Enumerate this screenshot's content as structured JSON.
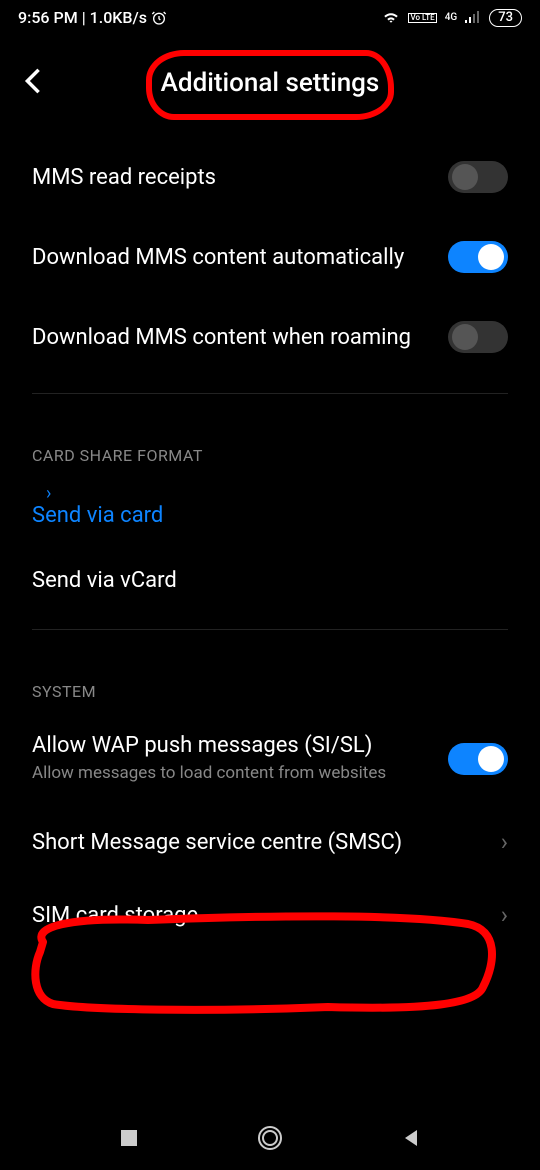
{
  "status": {
    "time": "9:56 PM",
    "speed": "1.0KB/s",
    "network": "4G",
    "volte": "Vo LTE",
    "battery": "73"
  },
  "header": {
    "title": "Additional settings"
  },
  "settings": {
    "mms_read_receipts": {
      "label": "MMS read receipts",
      "on": false
    },
    "download_auto": {
      "label": "Download MMS content automatically",
      "on": true
    },
    "download_roaming": {
      "label": "Download MMS content when roaming",
      "on": false
    }
  },
  "card_share": {
    "header": "CARD SHARE FORMAT",
    "via_card": "Send via card",
    "via_vcard": "Send via vCard"
  },
  "system": {
    "header": "SYSTEM",
    "wap": {
      "label": "Allow WAP push messages (SI/SL)",
      "sub": "Allow messages to load content from websites",
      "on": true
    },
    "smsc": "Short Message service centre (SMSC)",
    "sim_storage": "SIM card storage"
  }
}
